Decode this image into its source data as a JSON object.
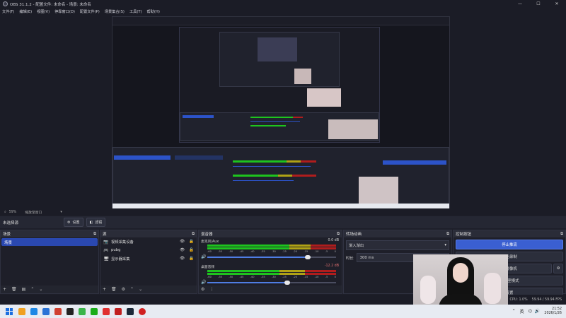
{
  "window": {
    "title": "OBS 31.1.2 - 配置文件: 未命名 - 场景: 未命名",
    "controls": [
      "—",
      "☐",
      "✕"
    ]
  },
  "menu": [
    "文件(F)",
    "编辑(E)",
    "视图(V)",
    "停靠窗口(D)",
    "配置文件(P)",
    "场景集合(S)",
    "工具(T)",
    "帮助(H)"
  ],
  "status_line": {
    "zoom": "59%",
    "label": "缩放至窗口"
  },
  "source_bar": {
    "none_selected": "未选择源",
    "properties": "设置",
    "filters": "滤镜"
  },
  "scenes": {
    "title": "场景",
    "items": [
      "场景"
    ]
  },
  "sources": {
    "title": "源",
    "items": [
      {
        "icon": "camera-icon",
        "glyph": "📷",
        "label": "视频采集设备"
      },
      {
        "icon": "gamepad-icon",
        "glyph": "🎮",
        "label": "pubg"
      },
      {
        "icon": "monitor-icon",
        "glyph": "🖥",
        "label": "显示器采集"
      }
    ]
  },
  "mixer": {
    "title": "混音器",
    "channels": [
      {
        "name": "麦克风/Aux",
        "db": "0.0 dB",
        "level": 0.78
      },
      {
        "name": "桌面音频",
        "db": "-12.2 dB",
        "level": 0.62
      }
    ],
    "scale": [
      "-60",
      "-55",
      "-50",
      "-45",
      "-40",
      "-35",
      "-30",
      "-25",
      "-20",
      "-15",
      "-10",
      "-5",
      "0"
    ]
  },
  "transitions": {
    "title": "转场动画",
    "selected": "渐入渐出",
    "duration_label": "时长",
    "duration": "300 ms"
  },
  "controls": {
    "title": "控制按钮",
    "buttons": [
      "停止推流",
      "开始录制",
      "启动虚拟摄像机",
      "工作室模式",
      "设置"
    ]
  },
  "stats": {
    "cpu": "CPU: 1.0%",
    "fps": "59.94 / 59.94 FPS"
  },
  "taskbar": {
    "time": "21:52",
    "date": "2026/1/26",
    "ime": "英",
    "icons": [
      "#1b6fe0",
      "#f0a020",
      "#1e88e5",
      "#2a73d6",
      "#d04030",
      "#222222",
      "#3ab54a",
      "#1aad19",
      "#e03030",
      "#c02020",
      "#1b2838",
      "#d02020"
    ]
  },
  "colors": {
    "accent": "#3a5fd1",
    "selection": "#2a48b0",
    "meter_green": "#1ec41e",
    "meter_yellow": "#b0a215",
    "meter_red": "#b01d1d"
  }
}
